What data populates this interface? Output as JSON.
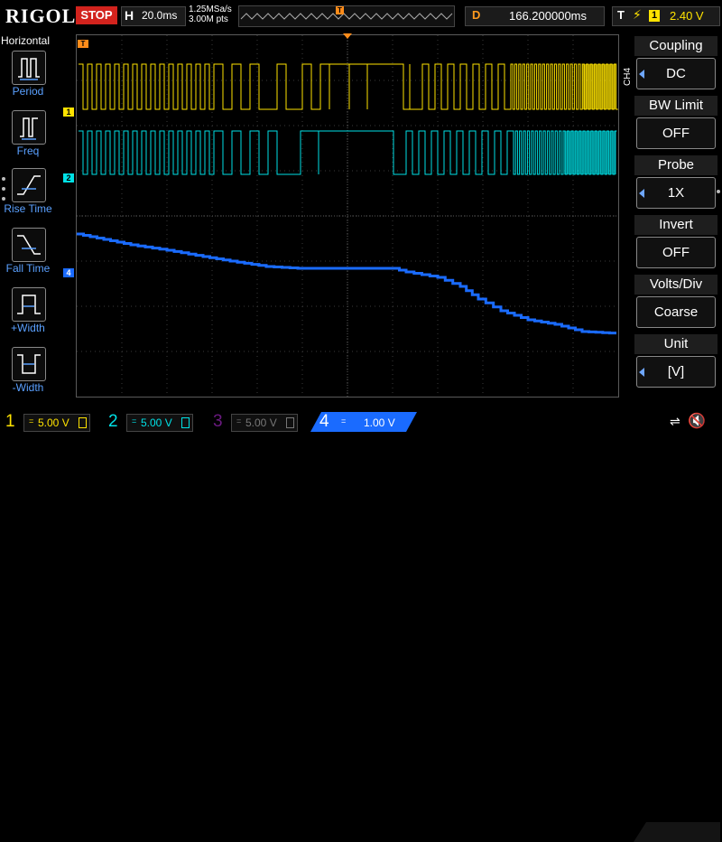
{
  "brand": "RIGOL",
  "run_state": "STOP",
  "timebase": {
    "label": "H",
    "value": "20.0ms"
  },
  "sample": {
    "rate": "1.25MSa/s",
    "points": "3.00M pts"
  },
  "trigger_marker": "T",
  "delay": {
    "label": "D",
    "value": "166.200000ms"
  },
  "trigger": {
    "label": "T",
    "edge_glyph": "⚡",
    "source": "1",
    "level": "2.40 V"
  },
  "left_menu": {
    "title": "Horizontal",
    "items": [
      {
        "label": "Period"
      },
      {
        "label": "Freq"
      },
      {
        "label": "Rise Time"
      },
      {
        "label": "Fall Time"
      },
      {
        "label": "+Width"
      },
      {
        "label": "-Width"
      }
    ]
  },
  "channel_markers": [
    {
      "label": "1"
    },
    {
      "label": "2"
    },
    {
      "label": "4"
    }
  ],
  "right_menu": {
    "channel": "CH4",
    "items": [
      {
        "title": "Coupling",
        "value": "DC"
      },
      {
        "title": "BW Limit",
        "value": "OFF"
      },
      {
        "title": "Probe",
        "value": "1X"
      },
      {
        "title": "Invert",
        "value": "OFF"
      },
      {
        "title": "Volts/Div",
        "value": "Coarse"
      },
      {
        "title": "Unit",
        "value": "[V]"
      }
    ]
  },
  "channels": [
    {
      "num": "1",
      "coupling": "=",
      "value": "5.00 V",
      "color": "#ffe300"
    },
    {
      "num": "2",
      "coupling": "=",
      "value": "5.00 V",
      "color": "#00e1e6"
    },
    {
      "num": "3",
      "coupling": "=",
      "value": "5.00 V",
      "color": "#a01cc8"
    },
    {
      "num": "4",
      "coupling": "=",
      "value": "1.00 V",
      "color": "#1a6bff"
    }
  ],
  "colors": {
    "ch1": "#ffe300",
    "ch2": "#00e1e6",
    "ch4": "#1a6bff",
    "trigger": "#ff8c1a",
    "stop": "#d2231d"
  }
}
